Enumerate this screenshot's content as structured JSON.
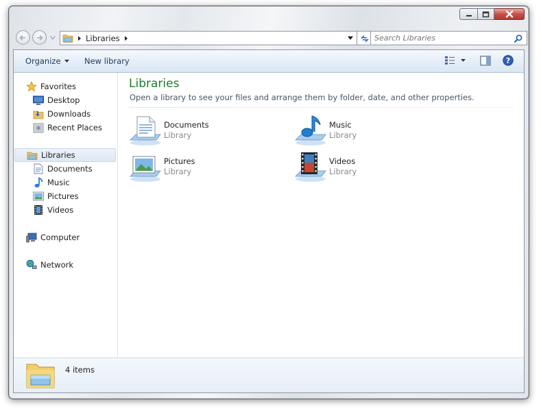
{
  "window": {
    "caption_buttons": {
      "minimize_icon": "minimize-icon",
      "maximize_icon": "maximize-icon",
      "close_icon": "close-icon"
    }
  },
  "address": {
    "crumbs": [
      "Libraries"
    ],
    "search_placeholder": "Search Libraries"
  },
  "toolbar": {
    "organize_label": "Organize",
    "new_library_label": "New library"
  },
  "nav": {
    "favorites": {
      "label": "Favorites",
      "items": [
        {
          "label": "Desktop"
        },
        {
          "label": "Downloads"
        },
        {
          "label": "Recent Places"
        }
      ]
    },
    "libraries": {
      "label": "Libraries",
      "items": [
        {
          "label": "Documents"
        },
        {
          "label": "Music"
        },
        {
          "label": "Pictures"
        },
        {
          "label": "Videos"
        }
      ]
    },
    "computer": {
      "label": "Computer"
    },
    "network": {
      "label": "Network"
    }
  },
  "content": {
    "title": "Libraries",
    "description": "Open a library to see your files and arrange them by folder, date, and other properties.",
    "tiles": [
      {
        "name": "Documents",
        "sub": "Library",
        "icon": "documents-library-icon"
      },
      {
        "name": "Music",
        "sub": "Library",
        "icon": "music-library-icon"
      },
      {
        "name": "Pictures",
        "sub": "Library",
        "icon": "pictures-library-icon"
      },
      {
        "name": "Videos",
        "sub": "Library",
        "icon": "videos-library-icon"
      }
    ]
  },
  "details": {
    "count": "4 items"
  },
  "colors": {
    "title_green": "#1f7a2e",
    "toolbar_text": "#1e395b",
    "selection": "#dde8f4"
  }
}
